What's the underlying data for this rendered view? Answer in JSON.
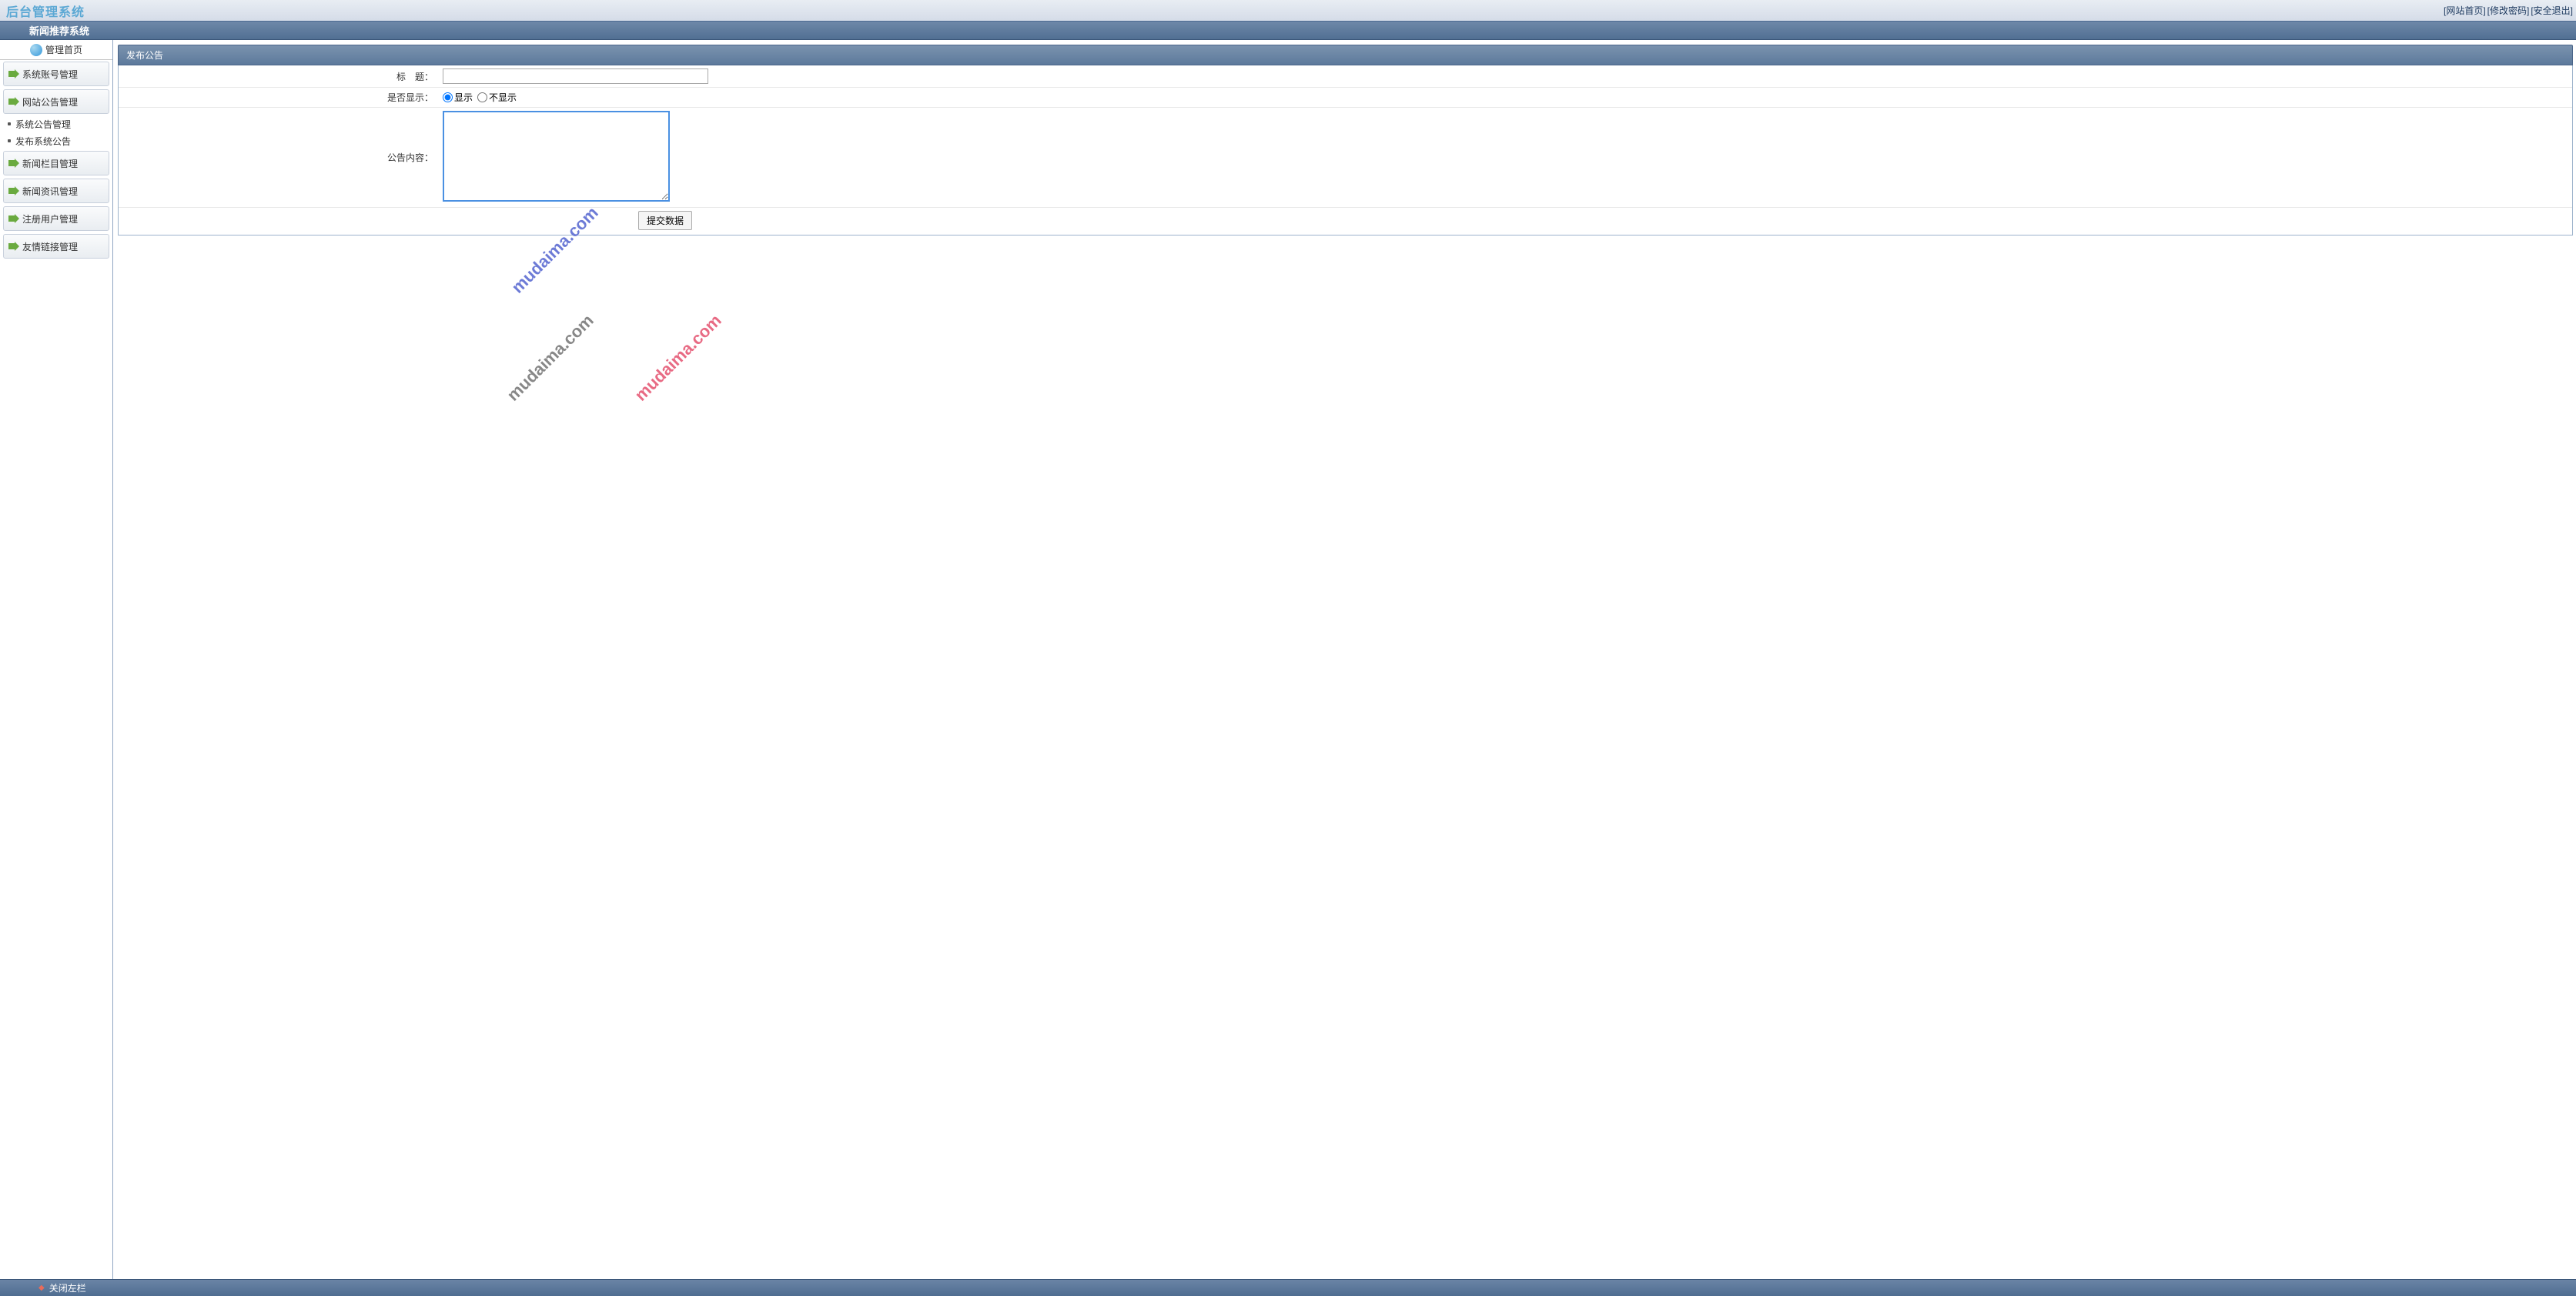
{
  "header": {
    "logo": "后台管理系统",
    "links": {
      "home": "[网站首页]",
      "password": "[修改密码]",
      "logout": "[安全退出]"
    }
  },
  "subheader": {
    "title": "新闻推荐系统"
  },
  "sidebar": {
    "home_label": "管理首页",
    "items": [
      {
        "label": "系统账号管理"
      },
      {
        "label": "网站公告管理"
      }
    ],
    "subs": [
      {
        "label": "系统公告管理"
      },
      {
        "label": "发布系统公告"
      }
    ],
    "items2": [
      {
        "label": "新闻栏目管理"
      },
      {
        "label": "新闻资讯管理"
      },
      {
        "label": "注册用户管理"
      },
      {
        "label": "友情链接管理"
      }
    ]
  },
  "panel": {
    "title": "发布公告"
  },
  "form": {
    "title_label": "标　题：",
    "title_value": "",
    "show_label": "是否显示：",
    "show_option_yes": "显示",
    "show_option_no": "不显示",
    "content_label": "公告内容：",
    "content_value": "",
    "submit_label": "提交数据"
  },
  "watermark": "mudaima.com",
  "footer": {
    "close_label": "关闭左栏"
  }
}
